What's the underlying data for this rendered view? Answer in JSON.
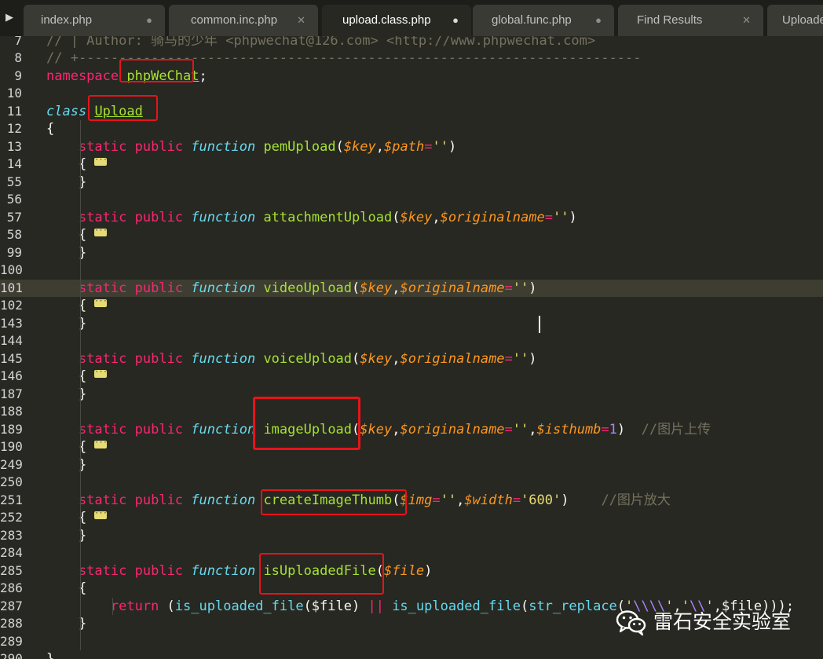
{
  "tabs": [
    {
      "label": "index.php",
      "close": "●",
      "active": false
    },
    {
      "label": "common.inc.php",
      "close": "✕",
      "active": false
    },
    {
      "label": "upload.class.php",
      "close": "●",
      "active": true
    },
    {
      "label": "global.func.php",
      "close": "●",
      "active": false
    },
    {
      "label": "Find Results",
      "close": "✕",
      "active": false
    },
    {
      "label": "Uploade",
      "close": "",
      "active": false
    }
  ],
  "nav_arrow": "▶",
  "lines": [
    {
      "n": "7",
      "tokens": [
        [
          "comment",
          "// | Author: 骑马的少年 <phpwechat@126.com> <http://www.phpwechat.com>"
        ]
      ]
    },
    {
      "n": "8",
      "tokens": [
        [
          "comment",
          "// +----------------------------------------------------------------------"
        ]
      ]
    },
    {
      "n": "9",
      "tokens": [
        [
          "kw",
          "namespace"
        ],
        [
          "plain",
          " "
        ],
        [
          "cls",
          "phpWeChat"
        ],
        [
          "plain",
          ";"
        ]
      ]
    },
    {
      "n": "10",
      "tokens": []
    },
    {
      "n": "11",
      "tokens": [
        [
          "store",
          "class"
        ],
        [
          "plain",
          " "
        ],
        [
          "cls",
          "Upload"
        ]
      ]
    },
    {
      "n": "12",
      "tokens": [
        [
          "plain",
          "{"
        ]
      ]
    },
    {
      "n": "13",
      "tokens": [
        [
          "plain",
          "    "
        ],
        [
          "kw",
          "static"
        ],
        [
          "plain",
          " "
        ],
        [
          "kw",
          "public"
        ],
        [
          "plain",
          " "
        ],
        [
          "store",
          "function"
        ],
        [
          "plain",
          " "
        ],
        [
          "fn",
          "pemUpload"
        ],
        [
          "plain",
          "("
        ],
        [
          "var",
          "$key"
        ],
        [
          "plain",
          ","
        ],
        [
          "var",
          "$path"
        ],
        [
          "op",
          "="
        ],
        [
          "str",
          "''"
        ],
        [
          "plain",
          ")"
        ]
      ]
    },
    {
      "n": "14",
      "fold": true,
      "tokens": [
        [
          "plain",
          "    { "
        ]
      ]
    },
    {
      "n": "55",
      "tokens": [
        [
          "plain",
          "    }"
        ]
      ]
    },
    {
      "n": "56",
      "tokens": []
    },
    {
      "n": "57",
      "tokens": [
        [
          "plain",
          "    "
        ],
        [
          "kw",
          "static"
        ],
        [
          "plain",
          " "
        ],
        [
          "kw",
          "public"
        ],
        [
          "plain",
          " "
        ],
        [
          "store",
          "function"
        ],
        [
          "plain",
          " "
        ],
        [
          "fn",
          "attachmentUpload"
        ],
        [
          "plain",
          "("
        ],
        [
          "var",
          "$key"
        ],
        [
          "plain",
          ","
        ],
        [
          "var",
          "$originalname"
        ],
        [
          "op",
          "="
        ],
        [
          "str",
          "''"
        ],
        [
          "plain",
          ")"
        ]
      ]
    },
    {
      "n": "58",
      "fold": true,
      "tokens": [
        [
          "plain",
          "    { "
        ]
      ]
    },
    {
      "n": "99",
      "tokens": [
        [
          "plain",
          "    }"
        ]
      ]
    },
    {
      "n": "100",
      "tokens": []
    },
    {
      "n": "101",
      "current": true,
      "tokens": [
        [
          "plain",
          "    "
        ],
        [
          "kw",
          "static"
        ],
        [
          "plain",
          " "
        ],
        [
          "kw",
          "public"
        ],
        [
          "plain",
          " "
        ],
        [
          "store",
          "function"
        ],
        [
          "plain",
          " "
        ],
        [
          "fn",
          "videoUpload"
        ],
        [
          "plain",
          "("
        ],
        [
          "var",
          "$key"
        ],
        [
          "plain",
          ","
        ],
        [
          "var",
          "$originalname"
        ],
        [
          "op",
          "="
        ],
        [
          "str",
          "''"
        ],
        [
          "plain",
          ")"
        ]
      ]
    },
    {
      "n": "102",
      "fold": true,
      "tokens": [
        [
          "plain",
          "    { "
        ]
      ]
    },
    {
      "n": "143",
      "tokens": [
        [
          "plain",
          "    }"
        ]
      ]
    },
    {
      "n": "144",
      "tokens": []
    },
    {
      "n": "145",
      "tokens": [
        [
          "plain",
          "    "
        ],
        [
          "kw",
          "static"
        ],
        [
          "plain",
          " "
        ],
        [
          "kw",
          "public"
        ],
        [
          "plain",
          " "
        ],
        [
          "store",
          "function"
        ],
        [
          "plain",
          " "
        ],
        [
          "fn",
          "voiceUpload"
        ],
        [
          "plain",
          "("
        ],
        [
          "var",
          "$key"
        ],
        [
          "plain",
          ","
        ],
        [
          "var",
          "$originalname"
        ],
        [
          "op",
          "="
        ],
        [
          "str",
          "''"
        ],
        [
          "plain",
          ")"
        ]
      ]
    },
    {
      "n": "146",
      "fold": true,
      "tokens": [
        [
          "plain",
          "    { "
        ]
      ]
    },
    {
      "n": "187",
      "tokens": [
        [
          "plain",
          "    }"
        ]
      ]
    },
    {
      "n": "188",
      "tokens": []
    },
    {
      "n": "189",
      "tokens": [
        [
          "plain",
          "    "
        ],
        [
          "kw",
          "static"
        ],
        [
          "plain",
          " "
        ],
        [
          "kw",
          "public"
        ],
        [
          "plain",
          " "
        ],
        [
          "store",
          "function"
        ],
        [
          "plain",
          " "
        ],
        [
          "fn",
          "imageUpload"
        ],
        [
          "plain",
          "("
        ],
        [
          "var",
          "$key"
        ],
        [
          "plain",
          ","
        ],
        [
          "var",
          "$originalname"
        ],
        [
          "op",
          "="
        ],
        [
          "str",
          "''"
        ],
        [
          "plain",
          ","
        ],
        [
          "var",
          "$isthumb"
        ],
        [
          "op",
          "="
        ],
        [
          "num",
          "1"
        ],
        [
          "plain",
          ")  "
        ],
        [
          "cmt",
          "//图片上传"
        ]
      ]
    },
    {
      "n": "190",
      "fold": true,
      "tokens": [
        [
          "plain",
          "    { "
        ]
      ]
    },
    {
      "n": "249",
      "tokens": [
        [
          "plain",
          "    }"
        ]
      ]
    },
    {
      "n": "250",
      "tokens": []
    },
    {
      "n": "251",
      "tokens": [
        [
          "plain",
          "    "
        ],
        [
          "kw",
          "static"
        ],
        [
          "plain",
          " "
        ],
        [
          "kw",
          "public"
        ],
        [
          "plain",
          " "
        ],
        [
          "store",
          "function"
        ],
        [
          "plain",
          " "
        ],
        [
          "fn",
          "createImageThumb"
        ],
        [
          "plain",
          "("
        ],
        [
          "var",
          "$img"
        ],
        [
          "op",
          "="
        ],
        [
          "str",
          "''"
        ],
        [
          "plain",
          ","
        ],
        [
          "var",
          "$width"
        ],
        [
          "op",
          "="
        ],
        [
          "str",
          "'600'"
        ],
        [
          "plain",
          ")    "
        ],
        [
          "cmt",
          "//图片放大"
        ]
      ]
    },
    {
      "n": "252",
      "fold": true,
      "tokens": [
        [
          "plain",
          "    { "
        ]
      ]
    },
    {
      "n": "283",
      "tokens": [
        [
          "plain",
          "    }"
        ]
      ]
    },
    {
      "n": "284",
      "tokens": []
    },
    {
      "n": "285",
      "tokens": [
        [
          "plain",
          "    "
        ],
        [
          "kw",
          "static"
        ],
        [
          "plain",
          " "
        ],
        [
          "kw",
          "public"
        ],
        [
          "plain",
          " "
        ],
        [
          "store",
          "function"
        ],
        [
          "plain",
          " "
        ],
        [
          "fn",
          "isUploadedFile"
        ],
        [
          "plain",
          "("
        ],
        [
          "var",
          "$file"
        ],
        [
          "plain",
          ")"
        ]
      ]
    },
    {
      "n": "286",
      "tokens": [
        [
          "plain",
          "    {"
        ]
      ]
    },
    {
      "n": "287",
      "tokens": [
        [
          "plain",
          "        "
        ],
        [
          "kw",
          "return"
        ],
        [
          "plain",
          " ("
        ],
        [
          "bi",
          "is_uploaded_file"
        ],
        [
          "plain",
          "($file) "
        ],
        [
          "op",
          "||"
        ],
        [
          "plain",
          " "
        ],
        [
          "bi",
          "is_uploaded_file"
        ],
        [
          "plain",
          "("
        ],
        [
          "bi",
          "str_replace"
        ],
        [
          "plain",
          "("
        ],
        [
          "str",
          "'"
        ],
        [
          "esc",
          "\\\\\\\\"
        ],
        [
          "str",
          "'"
        ],
        [
          "plain",
          ","
        ],
        [
          "str",
          "'"
        ],
        [
          "esc",
          "\\\\"
        ],
        [
          "str",
          "'"
        ],
        [
          "plain",
          ",$file)));"
        ]
      ]
    },
    {
      "n": "288",
      "tokens": [
        [
          "plain",
          "    }"
        ]
      ]
    },
    {
      "n": "289",
      "tokens": []
    },
    {
      "n": "290",
      "tokens": [
        [
          "plain",
          "}"
        ]
      ]
    }
  ],
  "watermark": {
    "icon": "wechat-icon",
    "text": "雷石安全实验室"
  },
  "colors": {
    "background": "#272822",
    "highlight_box": "#e8131a",
    "keyword": "#f92672",
    "function": "#a6e22e",
    "variable": "#fd971f",
    "string": "#e6db74",
    "comment": "#75715e",
    "storage": "#66d9ef"
  }
}
